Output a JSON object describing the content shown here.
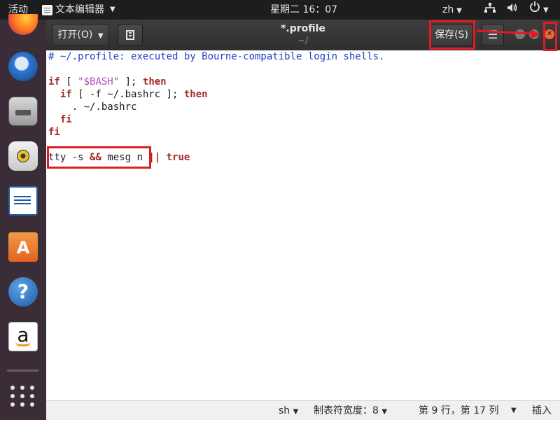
{
  "topbar": {
    "activities": "活动",
    "app_name": "文本编辑器",
    "clock": "星期二 16：07",
    "lang": "zh"
  },
  "dock": {
    "items": [
      "firefox-icon",
      "thunderbird-icon",
      "files-icon",
      "rhythmbox-icon",
      "libreoffice-writer-icon",
      "ubuntu-software-icon",
      "help-icon",
      "amazon-icon",
      "show-apps-icon"
    ]
  },
  "window": {
    "open_label": "打开(O)",
    "title": "*.profile",
    "path": "~/",
    "save_label": "保存(S)"
  },
  "editor": {
    "lines": [
      "# ~/.profile: executed by Bourne-compatible login shells.",
      "",
      "if [ \"$BASH\" ]; then",
      "  if [ -f ~/.bashrc ]; then",
      "    . ~/.bashrc",
      "  fi",
      "fi",
      "",
      "tty -s && mesg n || true"
    ]
  },
  "statusbar": {
    "language": "sh",
    "tab_width_label": "制表符宽度：",
    "tab_width": "8",
    "position": "第 9 行，第 17 列",
    "mode": "插入"
  },
  "colors": {
    "comment": "#1f3fc9",
    "keyword": "#a52a2a",
    "string": "#b04fb4",
    "annotation": "#e01b24",
    "close_button": "#ed6a3a"
  }
}
